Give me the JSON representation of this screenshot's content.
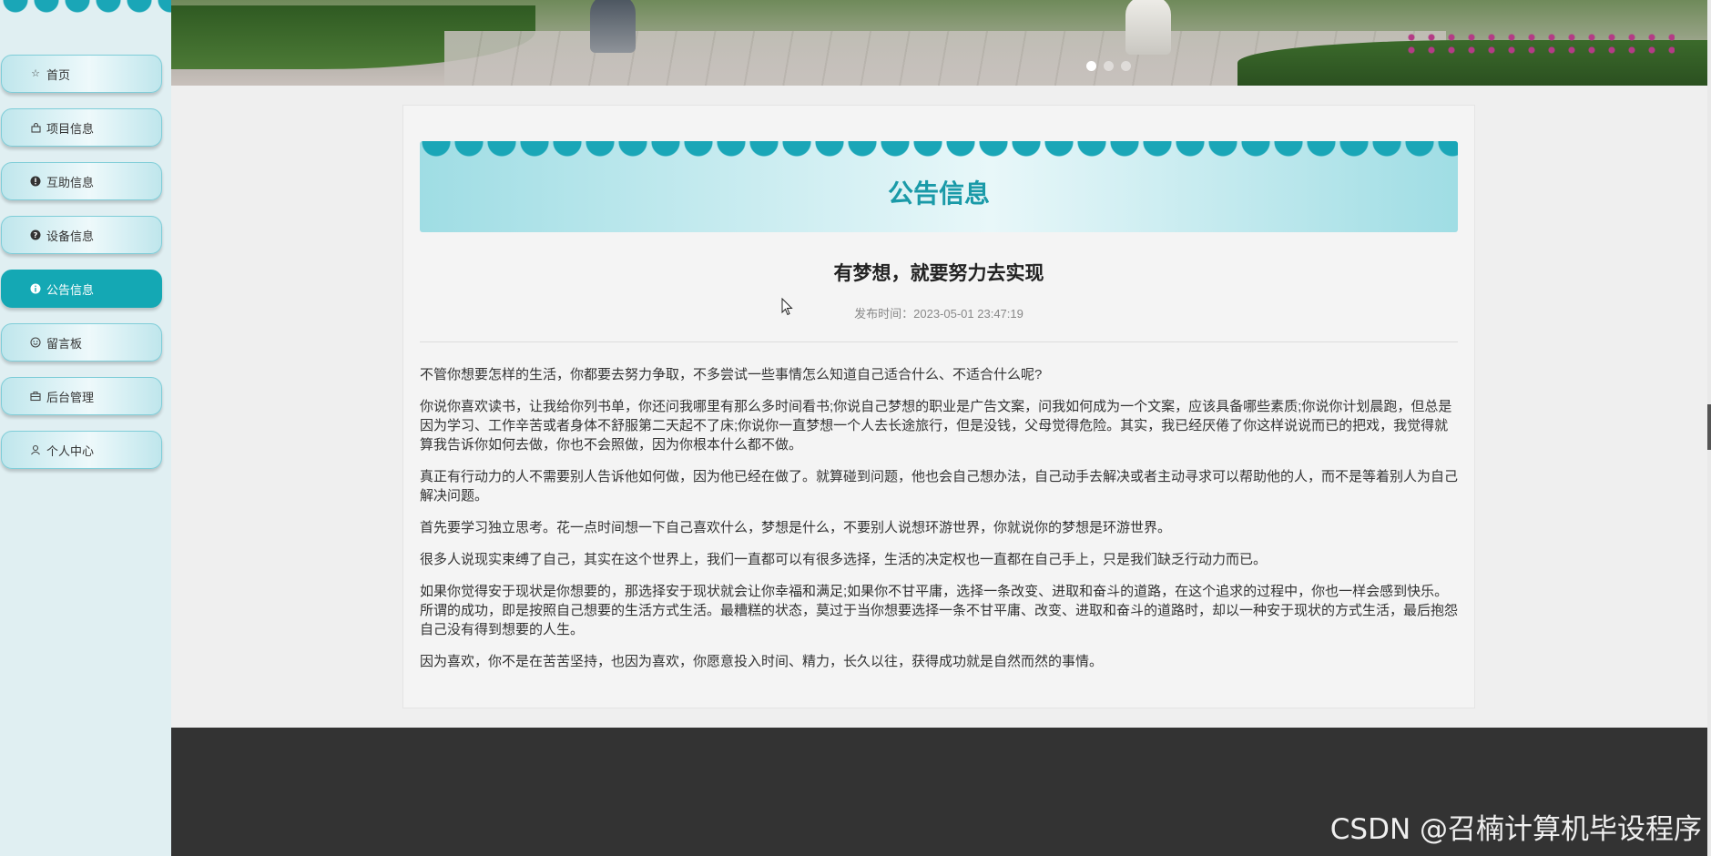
{
  "sidebar": {
    "items": [
      {
        "label": "首页",
        "icon": "star-icon"
      },
      {
        "label": "项目信息",
        "icon": "bag-icon"
      },
      {
        "label": "互助信息",
        "icon": "alert-circle-icon"
      },
      {
        "label": "设备信息",
        "icon": "question-circle-icon"
      },
      {
        "label": "公告信息",
        "icon": "info-circle-icon",
        "active": true
      },
      {
        "label": "留言板",
        "icon": "smile-icon"
      },
      {
        "label": "后台管理",
        "icon": "briefcase-icon"
      },
      {
        "label": "个人中心",
        "icon": "user-icon"
      }
    ]
  },
  "carousel": {
    "slide_count": 3,
    "active_index": 0
  },
  "page": {
    "section_title": "公告信息",
    "article_title": "有梦想，就要努力去实现",
    "publish_time": "发布时间：2023-05-01 23:47:19",
    "paragraphs": [
      "不管你想要怎样的生活，你都要去努力争取，不多尝试一些事情怎么知道自己适合什么、不适合什么呢?",
      "你说你喜欢读书，让我给你列书单，你还问我哪里有那么多时间看书;你说自己梦想的职业是广告文案，问我如何成为一个文案，应该具备哪些素质;你说你计划晨跑，但总是因为学习、工作辛苦或者身体不舒服第二天起不了床;你说你一直梦想一个人去长途旅行，但是没钱，父母觉得危险。其实，我已经厌倦了你这样说说而已的把戏，我觉得就算我告诉你如何去做，你也不会照做，因为你根本什么都不做。",
      "真正有行动力的人不需要别人告诉他如何做，因为他已经在做了。就算碰到问题，他也会自己想办法，自己动手去解决或者主动寻求可以帮助他的人，而不是等着别人为自己解决问题。",
      "首先要学习独立思考。花一点时间想一下自己喜欢什么，梦想是什么，不要别人说想环游世界，你就说你的梦想是环游世界。",
      "很多人说现实束缚了自己，其实在这个世界上，我们一直都可以有很多选择，生活的决定权也一直都在自己手上，只是我们缺乏行动力而已。",
      "如果你觉得安于现状是你想要的，那选择安于现状就会让你幸福和满足;如果你不甘平庸，选择一条改变、进取和奋斗的道路，在这个追求的过程中，你也一样会感到快乐。所谓的成功，即是按照自己想要的生活方式生活。最糟糕的状态，莫过于当你想要选择一条不甘平庸、改变、进取和奋斗的道路时，却以一种安于现状的方式生活，最后抱怨自己没有得到想要的人生。",
      "因为喜欢，你不是在苦苦坚持，也因为喜欢，你愿意投入时间、精力，长久以往，获得成功就是自然而然的事情。"
    ]
  },
  "watermark": "CSDN @召楠计算机毕设程序",
  "colors": {
    "accent": "#14a8b4",
    "footer": "#333333"
  }
}
